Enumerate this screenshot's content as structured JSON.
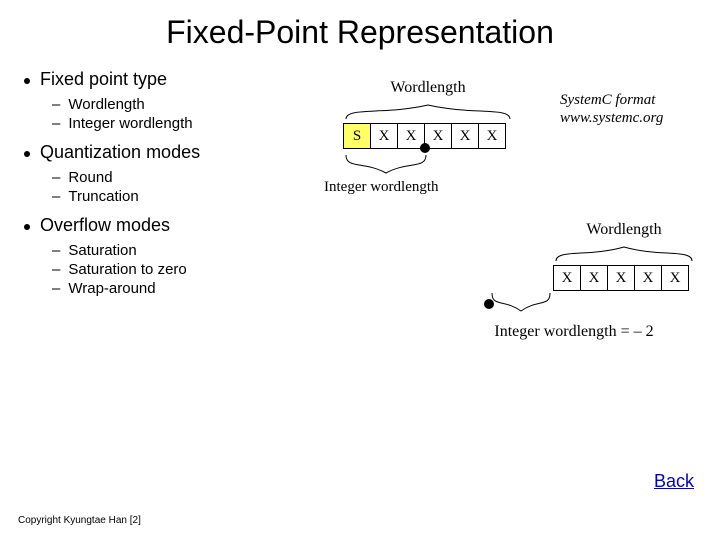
{
  "title": "Fixed-Point Representation",
  "bullets": {
    "b1": "Fixed point type",
    "b1a": "Wordlength",
    "b1b": "Integer wordlength",
    "b2": "Quantization modes",
    "b2a": "Round",
    "b2b": "Truncation",
    "b3": "Overflow modes",
    "b3a": "Saturation",
    "b3b": "Saturation to zero",
    "b3c": "Wrap-around"
  },
  "diagram1": {
    "wordlength_label": "Wordlength",
    "cells": {
      "s": "S",
      "x": "X"
    },
    "int_label": "Integer wordlength"
  },
  "systemc": {
    "line1": "SystemC format",
    "line2": "www.systemc.org"
  },
  "diagram2": {
    "wordlength_label": "Wordlength",
    "x": "X",
    "neg_label": "Integer wordlength = – 2"
  },
  "back": "Back",
  "copyright": "Copyright Kyungtae Han [2]"
}
